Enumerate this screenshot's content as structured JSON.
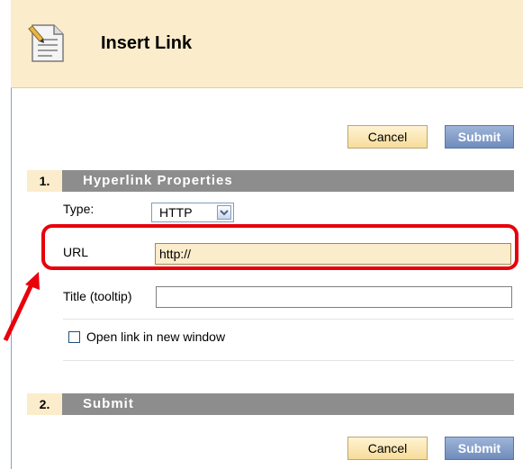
{
  "dialog": {
    "title": "Insert Link",
    "icon": "document-edit-icon"
  },
  "actions_top": {
    "cancel_label": "Cancel",
    "submit_label": "Submit"
  },
  "section1": {
    "number": "1.",
    "title": "Hyperlink Properties",
    "type_label": "Type:",
    "type_value": "HTTP",
    "url_label": "URL",
    "url_value": "http://",
    "title_label": "Title (tooltip)",
    "title_value": "",
    "new_window_label": "Open link in new window",
    "new_window_checked": false
  },
  "section2": {
    "number": "2.",
    "title": "Submit"
  },
  "actions_bottom": {
    "cancel_label": "Cancel",
    "submit_label": "Submit"
  },
  "annotation": {
    "highlight_color": "#e8000b"
  },
  "colors": {
    "header_bg": "#fbeccb",
    "section_bar": "#8d8d8d",
    "submit_button": "#6f8cbc"
  }
}
